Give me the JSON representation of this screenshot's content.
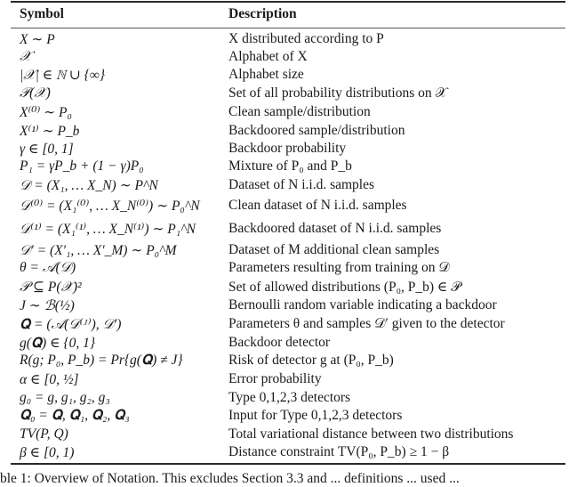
{
  "table": {
    "headers": {
      "symbol": "Symbol",
      "description": "Description"
    },
    "rows": [
      {
        "symbol": "X ∼ P",
        "description": "X distributed according to P"
      },
      {
        "symbol": "𝒳",
        "description": "Alphabet of X"
      },
      {
        "symbol": "|𝒳| ∈ ℕ ∪ {∞}",
        "description": "Alphabet size"
      },
      {
        "symbol": "𝒫(𝒳)",
        "description": "Set of all probability distributions on 𝒳"
      },
      {
        "symbol": "X⁽⁰⁾ ∼ P₀",
        "description": "Clean sample/distribution"
      },
      {
        "symbol": "X⁽¹⁾ ∼ P_b",
        "description": "Backdoored sample/distribution"
      },
      {
        "symbol": "γ ∈ [0, 1]",
        "description": "Backdoor probability"
      },
      {
        "symbol": "P₁ = γP_b + (1 − γ)P₀",
        "description": "Mixture of P₀ and P_b"
      },
      {
        "symbol": "𝒟 = (X₁, … X_N) ∼ P^N",
        "description": "Dataset of N i.i.d. samples"
      },
      {
        "symbol": "𝒟⁽⁰⁾ = (X₁⁽⁰⁾, … X_N⁽⁰⁾) ∼ P₀^N",
        "description": "Clean dataset of N i.i.d. samples"
      },
      {
        "symbol": "𝒟⁽¹⁾ = (X₁⁽¹⁾, … X_N⁽¹⁾) ∼ P₁^N",
        "description": "Backdoored dataset of N i.i.d. samples"
      },
      {
        "symbol": "𝒟′ = (X′₁, … X′_M) ∼ P₀^M",
        "description": "Dataset of M additional clean samples"
      },
      {
        "symbol": "θ = 𝒜(𝒟)",
        "description": "Parameters resulting from training on 𝒟"
      },
      {
        "symbol": "𝒫 ⊆ P(𝒳)²",
        "description": "Set of allowed distributions (P₀, P_b) ∈ 𝒫"
      },
      {
        "symbol": "J ∼ ℬ(½)",
        "description": "Bernoulli random variable indicating a backdoor"
      },
      {
        "symbol": "𝐐 = (𝒜(𝒟⁽ᴶ⁾), 𝒟′)",
        "description": "Parameters θ and samples 𝒟′ given to the detector"
      },
      {
        "symbol": "g(𝐐) ∈ {0, 1}",
        "description": "Backdoor detector"
      },
      {
        "symbol": "R(g; P₀, P_b) = Pr{g(𝐐) ≠ J}",
        "description": "Risk of detector g at (P₀, P_b)"
      },
      {
        "symbol": "α ∈ [0, ½]",
        "description": "Error probability"
      },
      {
        "symbol": "g₀ = g, g₁, g₂, g₃",
        "description": "Type 0,1,2,3 detectors"
      },
      {
        "symbol": "𝐐₀ = 𝐐, 𝐐₁, 𝐐₂, 𝐐₃",
        "description": "Input for Type 0,1,2,3 detectors"
      },
      {
        "symbol": "TV(P, Q)",
        "description": "Total variational distance between two distributions"
      },
      {
        "symbol": "β ∈ [0, 1)",
        "description": "Distance constraint TV(P₀, P_b) ≥ 1 − β"
      }
    ]
  },
  "caption": "ble 1: Overview of Notation. This excludes Section 3.3 and ... definitions ... used ..."
}
